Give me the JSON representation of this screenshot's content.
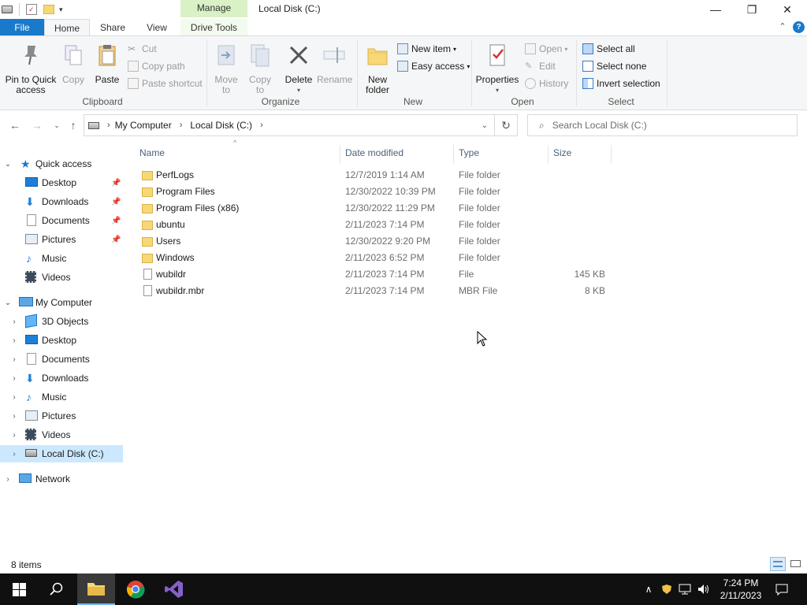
{
  "window": {
    "title": "Local Disk (C:)",
    "contextual_tab": "Manage",
    "controls": {
      "minimize": "—",
      "restore": "❐",
      "close": "✕"
    }
  },
  "ribbon_tabs": {
    "file": "File",
    "home": "Home",
    "share": "Share",
    "view": "View",
    "drive_tools": "Drive Tools"
  },
  "ribbon": {
    "clipboard": {
      "label": "Clipboard",
      "pin_line1": "Pin to Quick",
      "pin_line2": "access",
      "copy": "Copy",
      "paste": "Paste",
      "cut": "Cut",
      "copy_path": "Copy path",
      "paste_shortcut": "Paste shortcut"
    },
    "organize": {
      "label": "Organize",
      "move_line1": "Move",
      "move_line2": "to",
      "copy_line1": "Copy",
      "copy_line2": "to",
      "delete": "Delete",
      "rename": "Rename"
    },
    "new": {
      "label": "New",
      "new_folder_line1": "New",
      "new_folder_line2": "folder",
      "new_item": "New item",
      "easy_access": "Easy access"
    },
    "open": {
      "label": "Open",
      "properties": "Properties",
      "open": "Open",
      "edit": "Edit",
      "history": "History"
    },
    "select": {
      "label": "Select",
      "select_all": "Select all",
      "select_none": "Select none",
      "invert_selection": "Invert selection"
    }
  },
  "address": {
    "crumbs": [
      "My Computer",
      "Local Disk (C:)"
    ],
    "search_placeholder": "Search Local Disk (C:)"
  },
  "nav": {
    "quick_access": "Quick access",
    "quick_items": [
      "Desktop",
      "Downloads",
      "Documents",
      "Pictures",
      "Music",
      "Videos"
    ],
    "my_computer": "My Computer",
    "computer_items": [
      "3D Objects",
      "Desktop",
      "Documents",
      "Downloads",
      "Music",
      "Pictures",
      "Videos",
      "Local Disk (C:)"
    ],
    "network": "Network"
  },
  "columns": {
    "name": "Name",
    "date": "Date modified",
    "type": "Type",
    "size": "Size"
  },
  "files": [
    {
      "name": "PerfLogs",
      "date": "12/7/2019 1:14 AM",
      "type": "File folder",
      "size": ""
    },
    {
      "name": "Program Files",
      "date": "12/30/2022 10:39 PM",
      "type": "File folder",
      "size": ""
    },
    {
      "name": "Program Files (x86)",
      "date": "12/30/2022 11:29 PM",
      "type": "File folder",
      "size": ""
    },
    {
      "name": "ubuntu",
      "date": "2/11/2023 7:14 PM",
      "type": "File folder",
      "size": ""
    },
    {
      "name": "Users",
      "date": "12/30/2022 9:20 PM",
      "type": "File folder",
      "size": ""
    },
    {
      "name": "Windows",
      "date": "2/11/2023 6:52 PM",
      "type": "File folder",
      "size": ""
    },
    {
      "name": "wubildr",
      "date": "2/11/2023 7:14 PM",
      "type": "File",
      "size": "145 KB"
    },
    {
      "name": "wubildr.mbr",
      "date": "2/11/2023 7:14 PM",
      "type": "MBR File",
      "size": "8 KB"
    }
  ],
  "status": {
    "item_count": "8 items"
  },
  "taskbar": {
    "time": "7:24 PM",
    "date": "2/11/2023"
  },
  "colors": {
    "accent": "#1979ca",
    "selection": "#cce8ff",
    "folder": "#f8d775",
    "taskbar": "#101010"
  }
}
